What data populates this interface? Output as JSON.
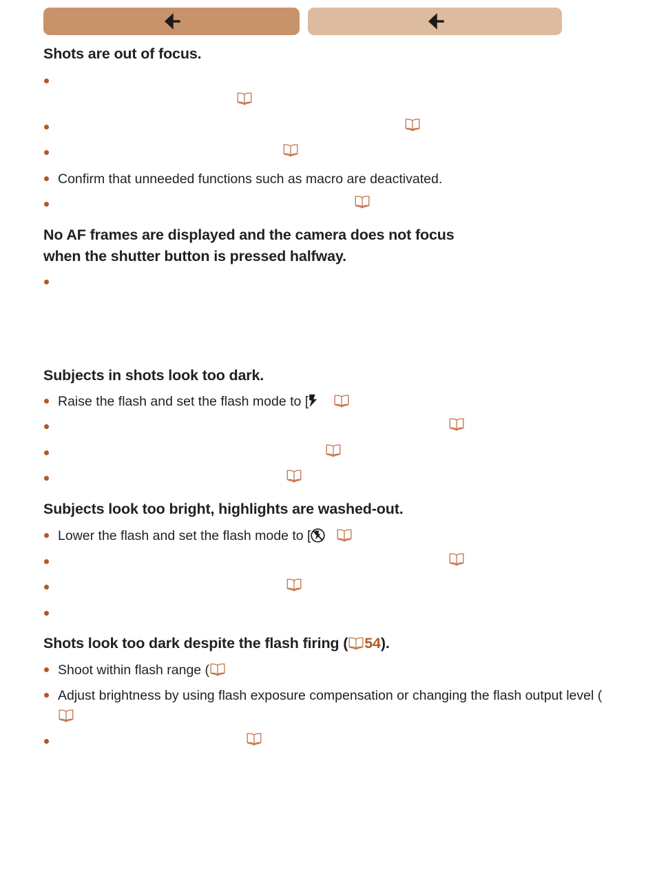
{
  "page": {
    "background": "#ffffff",
    "accent_color": "#b4591f",
    "text_color": "#231f20"
  },
  "tabbar": {
    "prev_tab": {
      "icon": "arrow-left-icon",
      "label": "",
      "color": "#c8936a"
    },
    "next_tab": {
      "icon": "arrow-left-icon",
      "label": "",
      "color": "#ddbb9e"
    }
  },
  "sections": [
    {
      "id": "shots-out-of-focus",
      "heading": "Shots are out of focus.",
      "bullets": [
        {
          "text": "",
          "icons": [
            "book-icon"
          ]
        },
        {
          "text": "",
          "icons": [
            "book-icon"
          ]
        },
        {
          "text": "",
          "icons": [
            "book-icon"
          ]
        },
        {
          "text": "Confirm that unneeded functions such as macro are deactivated.",
          "icons": []
        },
        {
          "text": "",
          "icons": [
            "book-icon"
          ]
        }
      ]
    },
    {
      "id": "no-af-frames",
      "heading": "No AF frames are displayed and the camera does not focus when the shutter button is pressed halfway.",
      "bullets": [
        {
          "text": "",
          "icons": []
        }
      ]
    },
    {
      "id": "subjects-too-dark",
      "heading": "Subjects in shots look too dark.",
      "bullets": [
        {
          "text_before": "Raise the flash and set the flash mode to [",
          "inline_icon": "flash-icon",
          "text_after": "",
          "icons": [
            "book-icon"
          ]
        },
        {
          "text": "",
          "icons": [
            "book-icon"
          ]
        },
        {
          "text": "",
          "icons": [
            "book-icon"
          ]
        },
        {
          "text": "",
          "icons": [
            "book-icon"
          ]
        }
      ]
    },
    {
      "id": "subjects-too-bright",
      "heading": "Subjects look too bright, highlights are washed-out.",
      "bullets": [
        {
          "text_before": "Lower the flash and set the flash mode to [",
          "inline_icon": "flash-off-icon",
          "text_after": "",
          "icons": [
            "book-icon"
          ]
        },
        {
          "text": "",
          "icons": [
            "book-icon"
          ]
        },
        {
          "text": "",
          "icons": [
            "book-icon"
          ]
        },
        {
          "text": "",
          "icons": []
        }
      ]
    },
    {
      "id": "dark-despite-flash",
      "heading_before": "Shots look too dark despite the flash firing (",
      "heading_pageref": "54",
      "heading_after": ").",
      "bullets": [
        {
          "text": "Shoot within flash range (",
          "icons": [
            "book-icon"
          ]
        },
        {
          "text": "Adjust brightness by using flash exposure compensation or changing the flash output level (",
          "icons": [
            "book-icon"
          ]
        },
        {
          "text": "",
          "icons": [
            "book-icon"
          ]
        }
      ]
    }
  ],
  "text": {
    "heading_1": "Shots are out of focus.",
    "heading_2": "No AF frames are displayed and the camera does not focus",
    "heading_2b": "when the shutter button is pressed halfway.",
    "heading_3": "Subjects in shots look too dark.",
    "heading_4": "Subjects look too bright, highlights are washed-out.",
    "heading_5_before": "Shots look too dark despite the flash firing (",
    "heading_5_ref": "54",
    "heading_5_after": ").",
    "b_confirm_macro": "Confirm that unneeded functions such as macro are deactivated.",
    "b_raise_flash": "Raise the flash and set the flash mode to [",
    "b_lower_flash": "Lower the flash and set the flash mode to [",
    "b_shoot_range": "Shoot within flash range (",
    "b_adjust_brightness": "Adjust brightness by using flash exposure compensation or changing the",
    "b_adjust_brightness_2": "flash output level ("
  }
}
